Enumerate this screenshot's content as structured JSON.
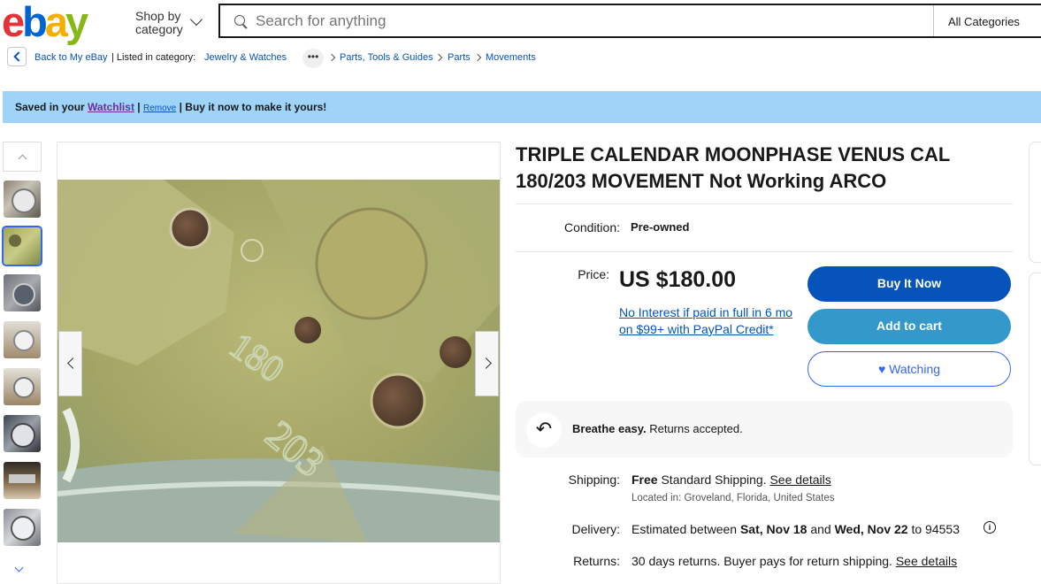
{
  "header": {
    "logo_letters": [
      "e",
      "b",
      "a",
      "y"
    ],
    "shop_by_line1": "Shop by",
    "shop_by_line2": "category",
    "search_placeholder": "Search for anything",
    "category_select": "All Categories"
  },
  "breadcrumb": {
    "back_label": "Back to My eBay",
    "listed_in": "| Listed in category:",
    "items": [
      "Jewelry & Watches",
      "Parts, Tools & Guides",
      "Parts",
      "Movements"
    ],
    "more": "•••"
  },
  "banner": {
    "prefix": "Saved in your",
    "watchlist_link": "Watchlist",
    "sep1": "|",
    "remove_link": "Remove",
    "suffix": "| Buy it now to make it yours!"
  },
  "listing": {
    "title": "TRIPLE CALENDAR MOONPHASE VENUS CAL 180/203 MOVEMENT Not Working ARCO",
    "condition_label": "Condition:",
    "condition_value": "Pre-owned",
    "price_label": "Price:",
    "price": "US $180.00",
    "credit_offer": "No Interest if paid in full in 6 mo on $99+ with PayPal Credit*",
    "buttons": {
      "buy_now": "Buy It Now",
      "add_to_cart": "Add to cart",
      "watching": "Watching"
    },
    "returns_banner_bold": "Breathe easy.",
    "returns_banner_rest": "Returns accepted.",
    "shipping_label": "Shipping:",
    "shipping_bold": "Free",
    "shipping_rest": "Standard Shipping.",
    "shipping_link": "See details",
    "location": "Located in: Groveland, Florida, United States",
    "delivery_label": "Delivery:",
    "delivery_pre": "Estimated between",
    "delivery_start": "Sat, Nov 18",
    "delivery_and": "and",
    "delivery_end": "Wed, Nov 22",
    "delivery_zip": "to 94553",
    "returns_label": "Returns:",
    "returns_text": "30 days returns. Buyer pays for return shipping.",
    "returns_link": "See details"
  },
  "icons": {
    "heart": "♥",
    "info": "i",
    "return_arrow": "↶"
  }
}
